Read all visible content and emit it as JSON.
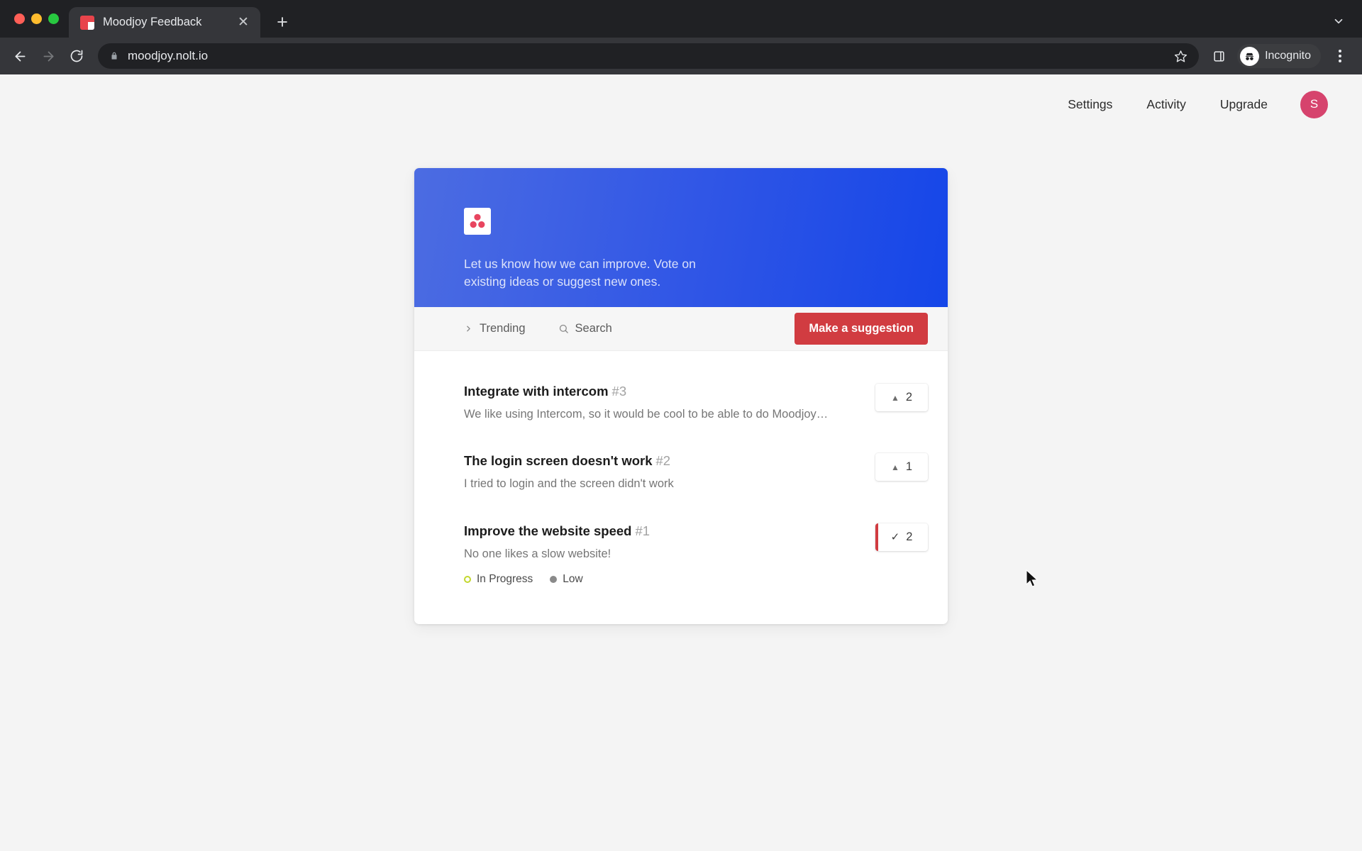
{
  "browser": {
    "tab": {
      "title": "Moodjoy Feedback",
      "favicon": "moodjoy-favicon-icon",
      "close_label": "✕"
    },
    "new_tab_label": "+",
    "tab_list_chevron": "chevron-down-icon",
    "toolbar": {
      "back": "back-arrow-icon",
      "forward": "forward-arrow-icon",
      "reload": "reload-icon",
      "lock": "lock-icon",
      "url": "moodjoy.nolt.io",
      "bookmark": "star-icon",
      "side_panel": "side-panel-icon",
      "profile_label": "Incognito",
      "menu": "kebab-menu-icon"
    }
  },
  "page": {
    "nav": {
      "links": [
        {
          "label": "Settings"
        },
        {
          "label": "Activity"
        },
        {
          "label": "Upgrade"
        }
      ],
      "avatar_initial": "S"
    },
    "board": {
      "header": {
        "logo_name": "moodjoy-logo",
        "tagline": "Let us know how we can improve. Vote on existing ideas or suggest new ones."
      },
      "toolbar": {
        "sort_label": "Trending",
        "sort_icon": "chevron-right-icon",
        "search_label": "Search",
        "search_icon": "search-icon",
        "suggest_button": "Make a suggestion"
      },
      "posts": [
        {
          "title": "Integrate with intercom",
          "number": "#3",
          "description": "We like using Intercom, so it would be cool to be able to do Moodjoy…",
          "vote_count": "2",
          "voted": false,
          "vote_icon": "▲",
          "badges": []
        },
        {
          "title": "The login screen doesn't work",
          "number": "#2",
          "description": "I tried to login and the screen didn't work",
          "vote_count": "1",
          "voted": false,
          "vote_icon": "▲",
          "badges": []
        },
        {
          "title": "Improve the website speed",
          "number": "#1",
          "description": "No one likes a slow website!",
          "vote_count": "2",
          "voted": true,
          "vote_icon": "✓",
          "badges": [
            {
              "label": "In Progress",
              "style": "ring",
              "color": "#c3d82e"
            },
            {
              "label": "Low",
              "style": "fill",
              "color": "#8a8a8a"
            }
          ]
        }
      ]
    }
  },
  "colors": {
    "accent_red": "#d13c41",
    "header_blue_start": "#4c6ce2",
    "header_blue_end": "#1546e8",
    "avatar_pink": "#d6436d",
    "status_in_progress": "#c3d82e",
    "priority_low": "#8a8a8a"
  }
}
